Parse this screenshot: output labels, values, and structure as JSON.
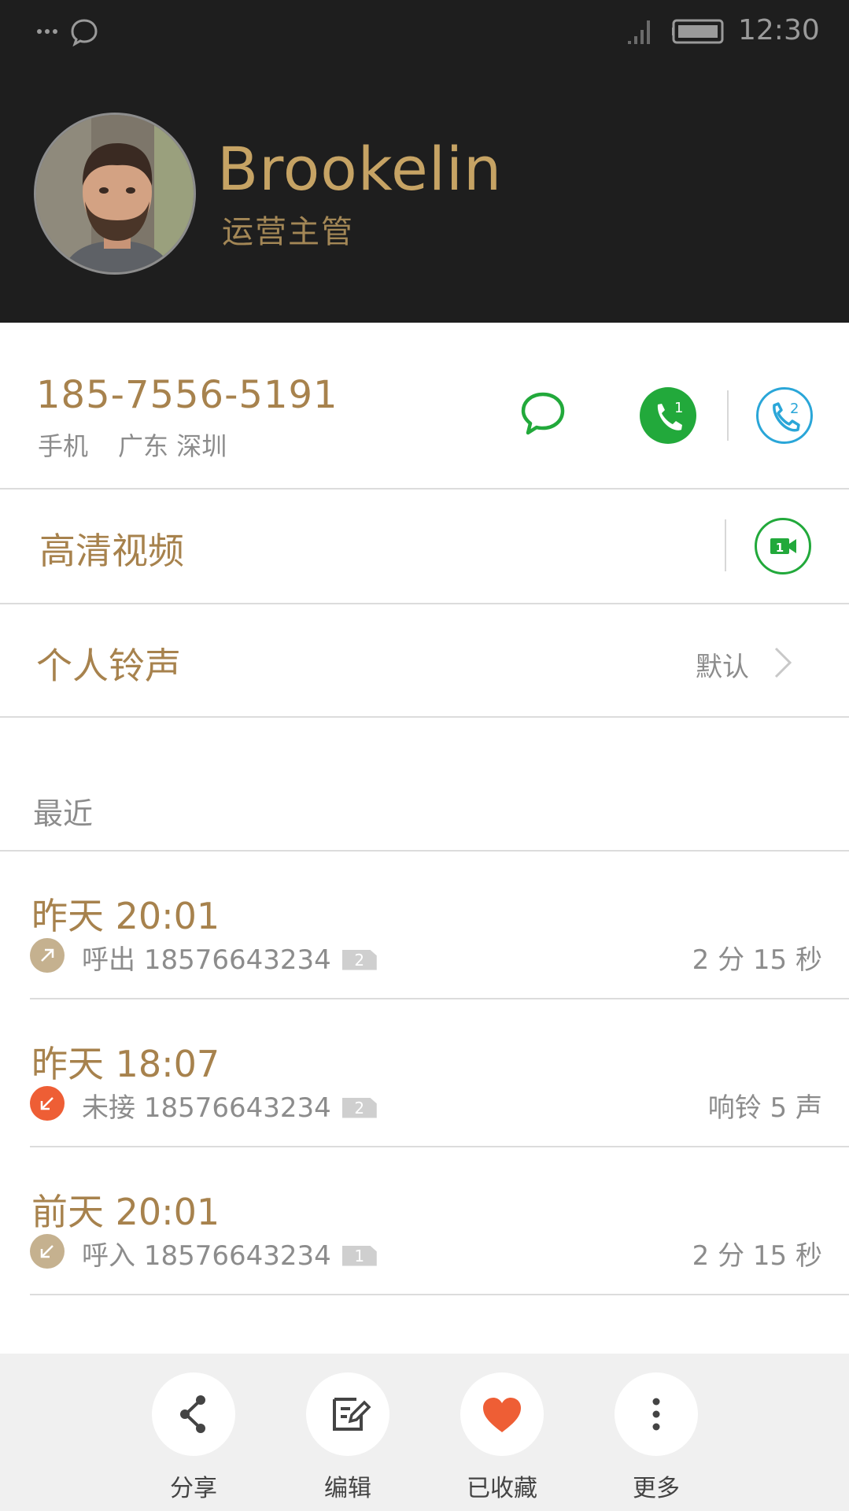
{
  "status_bar": {
    "time": "12:30",
    "icons": [
      "more-dots-icon",
      "chat-bubble-icon",
      "signal-icon",
      "battery-icon"
    ]
  },
  "contact": {
    "name": "Brookelin",
    "title": "运营主管",
    "avatar": "avatar-photo"
  },
  "phone": {
    "number": "185-7556-5191",
    "type": "手机",
    "location": "广东 深圳",
    "sim1_label": "1",
    "sim2_label": "2"
  },
  "video": {
    "label": "高清视频",
    "sim_label": "1"
  },
  "ringtone": {
    "label": "个人铃声",
    "value": "默认"
  },
  "recent": {
    "header": "最近",
    "calls": [
      {
        "time": "昨天 20:01",
        "type": "呼出",
        "number": "18576643234",
        "sim": "2",
        "duration": "2 分 15 秒",
        "icon": "outgoing-call-icon",
        "icon_color": "#c5b18f"
      },
      {
        "time": "昨天 18:07",
        "type": "未接",
        "number": "18576643234",
        "sim": "2",
        "duration": "响铃 5 声",
        "icon": "missed-call-icon",
        "icon_color": "#ee5e35"
      },
      {
        "time": "前天 20:01",
        "type": "呼入",
        "number": "18576643234",
        "sim": "1",
        "duration": "2 分 15 秒",
        "icon": "incoming-call-icon",
        "icon_color": "#c5b18f"
      }
    ]
  },
  "bottom_bar": {
    "share": "分享",
    "edit": "编辑",
    "favorite": "已收藏",
    "more": "更多"
  },
  "colors": {
    "header_bg": "#1e1e1e",
    "name_gold": "#c6a364",
    "text_gold": "#a7824d",
    "call_green": "#22a93b",
    "sim2_blue": "#2aa6d8",
    "favorite_red": "#ee5e35"
  }
}
